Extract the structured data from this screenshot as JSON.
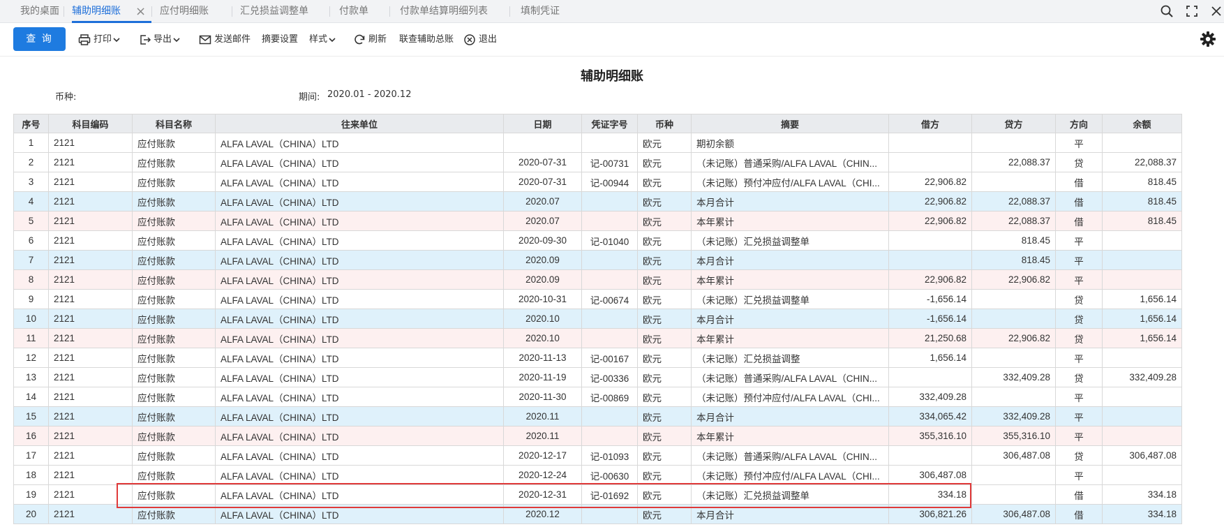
{
  "tabs": [
    {
      "label": "我的桌面",
      "active": false
    },
    {
      "label": "辅助明细账",
      "active": true
    },
    {
      "label": "应付明细账",
      "active": false
    },
    {
      "label": "汇兑损益调整单",
      "active": false
    },
    {
      "label": "付款单",
      "active": false
    },
    {
      "label": "付款单结算明细列表",
      "active": false
    },
    {
      "label": "填制凭证",
      "active": false
    }
  ],
  "toolbar": {
    "query": "查 询",
    "print": "打印",
    "export": "导出",
    "send_mail": "发送邮件",
    "summary_settings": "摘要设置",
    "style": "样式",
    "refresh": "刷新",
    "linked_summary": "联查辅助总账",
    "exit": "退出"
  },
  "report": {
    "title": "辅助明细账",
    "currency_label": "币种:",
    "currency_value": "",
    "period_label": "期间:",
    "period_value": "2020.01 - 2020.12"
  },
  "table": {
    "columns": [
      "序号",
      "科目编码",
      "科目名称",
      "往来单位",
      "日期",
      "凭证字号",
      "币种",
      "摘要",
      "借方",
      "贷方",
      "方向",
      "余额"
    ],
    "rows": [
      {
        "kind": "normal",
        "no": "1",
        "code": "2121",
        "name": "应付账款",
        "partner": "ALFA LAVAL（CHINA）LTD",
        "date": "",
        "voucher": "",
        "currency": "欧元",
        "summary": "期初余额",
        "debit": "",
        "credit": "",
        "direction": "平",
        "balance": ""
      },
      {
        "kind": "normal",
        "no": "2",
        "code": "2121",
        "name": "应付账款",
        "partner": "ALFA LAVAL（CHINA）LTD",
        "date": "2020-07-31",
        "voucher": "记-00731",
        "currency": "欧元",
        "summary": "（未记账）普通采购/ALFA LAVAL（CHIN...",
        "debit": "",
        "credit": "22,088.37",
        "direction": "贷",
        "balance": "22,088.37"
      },
      {
        "kind": "normal",
        "no": "3",
        "code": "2121",
        "name": "应付账款",
        "partner": "ALFA LAVAL（CHINA）LTD",
        "date": "2020-07-31",
        "voucher": "记-00944",
        "currency": "欧元",
        "summary": "（未记账）预付冲应付/ALFA LAVAL（CHI...",
        "debit": "22,906.82",
        "credit": "",
        "direction": "借",
        "balance": "818.45"
      },
      {
        "kind": "month",
        "no": "4",
        "code": "2121",
        "name": "应付账款",
        "partner": "ALFA LAVAL（CHINA）LTD",
        "date": "2020.07",
        "voucher": "",
        "currency": "欧元",
        "summary": "本月合计",
        "debit": "22,906.82",
        "credit": "22,088.37",
        "direction": "借",
        "balance": "818.45"
      },
      {
        "kind": "year",
        "no": "5",
        "code": "2121",
        "name": "应付账款",
        "partner": "ALFA LAVAL（CHINA）LTD",
        "date": "2020.07",
        "voucher": "",
        "currency": "欧元",
        "summary": "本年累计",
        "debit": "22,906.82",
        "credit": "22,088.37",
        "direction": "借",
        "balance": "818.45"
      },
      {
        "kind": "normal",
        "no": "6",
        "code": "2121",
        "name": "应付账款",
        "partner": "ALFA LAVAL（CHINA）LTD",
        "date": "2020-09-30",
        "voucher": "记-01040",
        "currency": "欧元",
        "summary": "（未记账）汇兑损益调整单",
        "debit": "",
        "credit": "818.45",
        "direction": "平",
        "balance": ""
      },
      {
        "kind": "month",
        "no": "7",
        "code": "2121",
        "name": "应付账款",
        "partner": "ALFA LAVAL（CHINA）LTD",
        "date": "2020.09",
        "voucher": "",
        "currency": "欧元",
        "summary": "本月合计",
        "debit": "",
        "credit": "818.45",
        "direction": "平",
        "balance": ""
      },
      {
        "kind": "year",
        "no": "8",
        "code": "2121",
        "name": "应付账款",
        "partner": "ALFA LAVAL（CHINA）LTD",
        "date": "2020.09",
        "voucher": "",
        "currency": "欧元",
        "summary": "本年累计",
        "debit": "22,906.82",
        "credit": "22,906.82",
        "direction": "平",
        "balance": ""
      },
      {
        "kind": "normal",
        "no": "9",
        "code": "2121",
        "name": "应付账款",
        "partner": "ALFA LAVAL（CHINA）LTD",
        "date": "2020-10-31",
        "voucher": "记-00674",
        "currency": "欧元",
        "summary": "（未记账）汇兑损益调整单",
        "debit": "-1,656.14",
        "credit": "",
        "direction": "贷",
        "balance": "1,656.14"
      },
      {
        "kind": "month",
        "no": "10",
        "code": "2121",
        "name": "应付账款",
        "partner": "ALFA LAVAL（CHINA）LTD",
        "date": "2020.10",
        "voucher": "",
        "currency": "欧元",
        "summary": "本月合计",
        "debit": "-1,656.14",
        "credit": "",
        "direction": "贷",
        "balance": "1,656.14"
      },
      {
        "kind": "year",
        "no": "11",
        "code": "2121",
        "name": "应付账款",
        "partner": "ALFA LAVAL（CHINA）LTD",
        "date": "2020.10",
        "voucher": "",
        "currency": "欧元",
        "summary": "本年累计",
        "debit": "21,250.68",
        "credit": "22,906.82",
        "direction": "贷",
        "balance": "1,656.14"
      },
      {
        "kind": "normal",
        "no": "12",
        "code": "2121",
        "name": "应付账款",
        "partner": "ALFA LAVAL（CHINA）LTD",
        "date": "2020-11-13",
        "voucher": "记-00167",
        "currency": "欧元",
        "summary": "（未记账）汇兑损益调整",
        "debit": "1,656.14",
        "credit": "",
        "direction": "平",
        "balance": ""
      },
      {
        "kind": "normal",
        "no": "13",
        "code": "2121",
        "name": "应付账款",
        "partner": "ALFA LAVAL（CHINA）LTD",
        "date": "2020-11-19",
        "voucher": "记-00336",
        "currency": "欧元",
        "summary": "（未记账）普通采购/ALFA LAVAL（CHIN...",
        "debit": "",
        "credit": "332,409.28",
        "direction": "贷",
        "balance": "332,409.28"
      },
      {
        "kind": "normal",
        "no": "14",
        "code": "2121",
        "name": "应付账款",
        "partner": "ALFA LAVAL（CHINA）LTD",
        "date": "2020-11-30",
        "voucher": "记-00869",
        "currency": "欧元",
        "summary": "（未记账）预付冲应付/ALFA LAVAL（CHI...",
        "debit": "332,409.28",
        "credit": "",
        "direction": "平",
        "balance": ""
      },
      {
        "kind": "month",
        "no": "15",
        "code": "2121",
        "name": "应付账款",
        "partner": "ALFA LAVAL（CHINA）LTD",
        "date": "2020.11",
        "voucher": "",
        "currency": "欧元",
        "summary": "本月合计",
        "debit": "334,065.42",
        "credit": "332,409.28",
        "direction": "平",
        "balance": ""
      },
      {
        "kind": "year",
        "no": "16",
        "code": "2121",
        "name": "应付账款",
        "partner": "ALFA LAVAL（CHINA）LTD",
        "date": "2020.11",
        "voucher": "",
        "currency": "欧元",
        "summary": "本年累计",
        "debit": "355,316.10",
        "credit": "355,316.10",
        "direction": "平",
        "balance": ""
      },
      {
        "kind": "normal",
        "no": "17",
        "code": "2121",
        "name": "应付账款",
        "partner": "ALFA LAVAL（CHINA）LTD",
        "date": "2020-12-17",
        "voucher": "记-01093",
        "currency": "欧元",
        "summary": "（未记账）普通采购/ALFA LAVAL（CHIN...",
        "debit": "",
        "credit": "306,487.08",
        "direction": "贷",
        "balance": "306,487.08"
      },
      {
        "kind": "normal",
        "no": "18",
        "code": "2121",
        "name": "应付账款",
        "partner": "ALFA LAVAL（CHINA）LTD",
        "date": "2020-12-24",
        "voucher": "记-00630",
        "currency": "欧元",
        "summary": "（未记账）预付冲应付/ALFA LAVAL（CHI...",
        "debit": "306,487.08",
        "credit": "",
        "direction": "平",
        "balance": ""
      },
      {
        "kind": "normal",
        "no": "19",
        "code": "2121",
        "name": "应付账款",
        "partner": "ALFA LAVAL（CHINA）LTD",
        "date": "2020-12-31",
        "voucher": "记-01692",
        "currency": "欧元",
        "summary": "（未记账）汇兑损益调整单",
        "debit": "334.18",
        "credit": "",
        "direction": "借",
        "balance": "334.18"
      },
      {
        "kind": "month",
        "no": "20",
        "code": "2121",
        "name": "应付账款",
        "partner": "ALFA LAVAL（CHINA）LTD",
        "date": "2020.12",
        "voucher": "",
        "currency": "欧元",
        "summary": "本月合计",
        "debit": "306,821.26",
        "credit": "306,487.08",
        "direction": "借",
        "balance": "334.18"
      }
    ]
  },
  "colors": {
    "accent": "#1e7be0",
    "voucher_link": "#1e5fd9",
    "negative": "#e02020",
    "month_row_bg": "#dff1fb",
    "year_row_bg": "#fdf0f0",
    "highlight_border": "#e03a3a"
  },
  "icons": [
    "close-icon",
    "search-icon",
    "maximize-icon",
    "close-window-icon",
    "printer-icon",
    "export-icon",
    "mail-icon",
    "refresh-icon",
    "exit-icon",
    "gear-icon",
    "chevron-down-icon"
  ]
}
